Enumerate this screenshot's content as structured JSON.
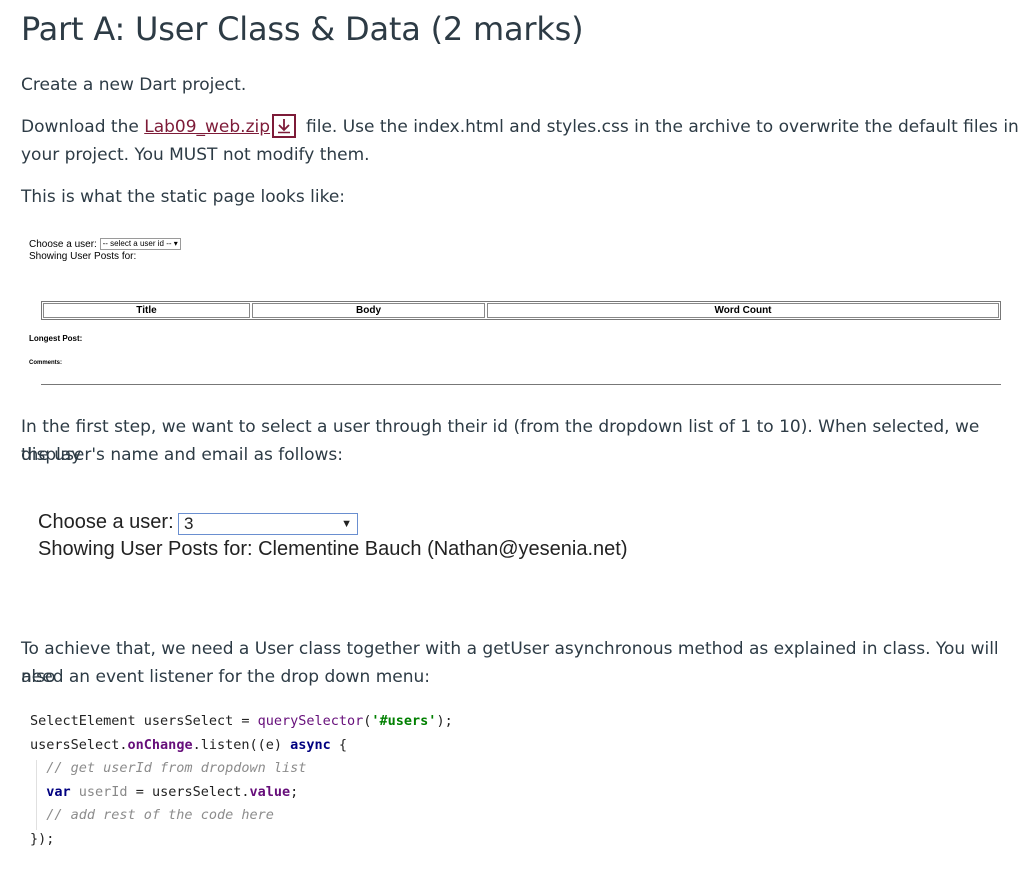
{
  "heading": "Part A: User Class & Data (2 marks)",
  "paragraphs": {
    "p1": "Create a new Dart project.",
    "p2_before": "Download the ",
    "p2_link": "Lab09_web.zip",
    "p2_after_line1": "file. Use the index.html and styles.css in the archive to overwrite the default files in",
    "p2_line2": "your project. You MUST not modify them.",
    "p3": "This is what the static page looks like:",
    "p4_line1": "In the first step, we want to select a user through their id (from the dropdown list of 1 to 10). When selected, we display",
    "p4_line2": "the user's name and email as follows:",
    "p5_line1": "To achieve that, we need a User class together with a getUser asynchronous method as explained in class. You will also",
    "p5_line2": "need an event listener for the drop down menu:"
  },
  "static_page": {
    "choose_label": "Choose a user:",
    "select_placeholder": "-- select a user id --",
    "showing_label": "Showing User Posts for:",
    "columns": [
      "Title",
      "Body",
      "Word Count"
    ],
    "longest_post": "Longest Post:",
    "comments": "Comments:"
  },
  "example": {
    "choose_label": "Choose a user:",
    "selected_value": "3",
    "showing_text": "Showing User Posts for: Clementine Bauch (Nathan@yesenia.net)"
  },
  "code": {
    "l1_type": "SelectElement",
    "l1_rest": " usersSelect = ",
    "l1_fn": "querySelector",
    "l1_open": "(",
    "l1_str": "'#users'",
    "l1_close": ");",
    "l2_a": "usersSelect.",
    "l2_fld": "onChange",
    "l2_b": ".listen((e) ",
    "l2_kw": "async",
    "l2_c": " {",
    "l3_cm": "// get userId from dropdown list",
    "l4_kw": "var",
    "l4_var": " userId",
    "l4_a": " = usersSelect.",
    "l4_fld": "value",
    "l4_b": ";",
    "l5_cm": "// add rest of the code here",
    "l6": "});"
  },
  "colors": {
    "link": "#7d1b38",
    "text": "#2d3b45"
  }
}
